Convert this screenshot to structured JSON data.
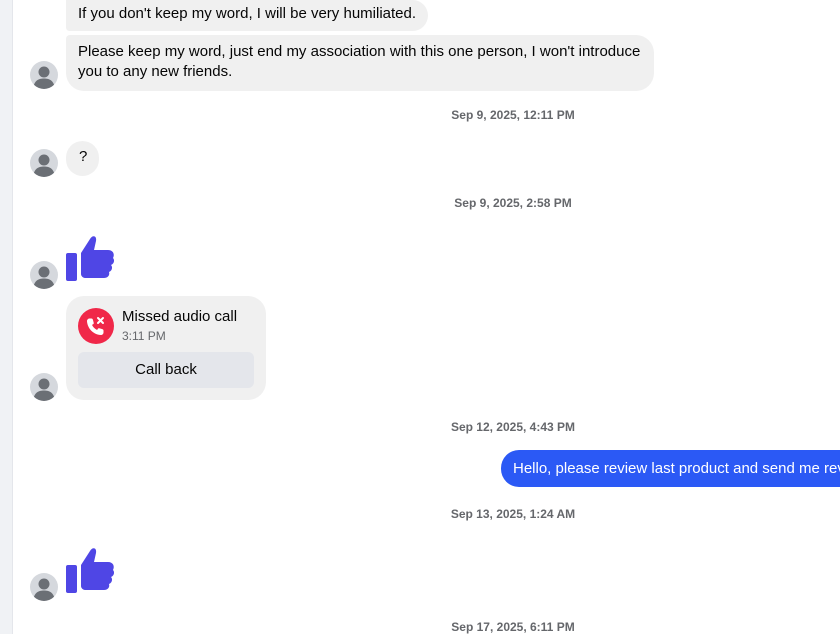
{
  "messages": {
    "msg1": "If you don't keep my word, I will be very humiliated.",
    "msg2": "Please keep my word, just end my association with this one person, I won't introduce you to any new friends.",
    "msg3": "?",
    "outgoing": "Hello, please review last product and send me rev"
  },
  "timestamps": {
    "t1": "Sep 9, 2025, 12:11 PM",
    "t2": "Sep 9, 2025, 2:58 PM",
    "t3": "Sep 12, 2025, 4:43 PM",
    "t4": "Sep 13, 2025, 1:24 AM",
    "t5": "Sep 17, 2025, 6:11 PM"
  },
  "call": {
    "title": "Missed audio call",
    "time": "3:11 PM",
    "button": "Call back"
  },
  "icons": {
    "like": "thumbs-up-icon",
    "avatar": "default-avatar-icon",
    "missed_call": "missed-call-icon"
  },
  "colors": {
    "like": "#4f46e5",
    "outgoing_bubble": "#2b59f5",
    "missed_call": "#f02849",
    "incoming_bubble": "#f0f0f0"
  }
}
